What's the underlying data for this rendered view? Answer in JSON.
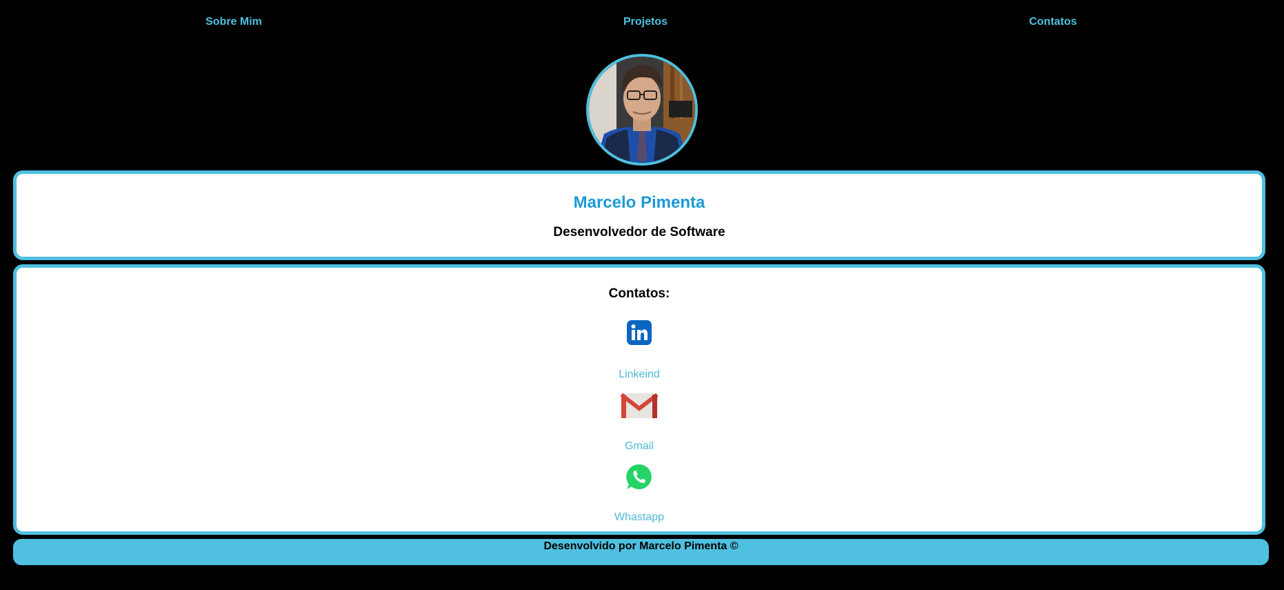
{
  "nav": {
    "items": [
      {
        "label": "Sobre Mim"
      },
      {
        "label": "Projetos"
      },
      {
        "label": "Contatos"
      }
    ]
  },
  "profile": {
    "name": "Marcelo Pimenta",
    "role": "Desenvolvedor de Software"
  },
  "contacts": {
    "title": "Contatos:",
    "items": [
      {
        "label": "Linkeind",
        "icon": "linkedin-icon",
        "color": "#0a66c2"
      },
      {
        "label": "Gmail",
        "icon": "gmail-icon",
        "color": "#d44638"
      },
      {
        "label": "Whastapp",
        "icon": "whatsapp-icon",
        "color": "#25d366"
      }
    ]
  },
  "footer": {
    "text": "Desenvolvido por Marcelo Pimenta ©"
  },
  "colors": {
    "accent": "#4fc0df",
    "name": "#1b9ad6",
    "background": "#000000"
  }
}
